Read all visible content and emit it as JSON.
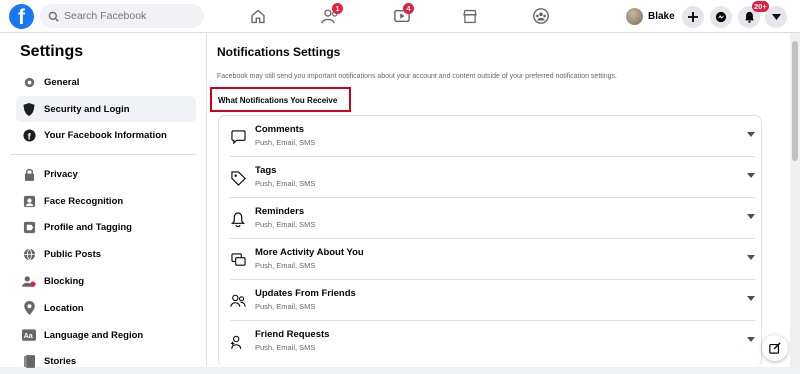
{
  "topbar": {
    "logo": "f",
    "search_placeholder": "Search Facebook",
    "badges": {
      "friends": "1",
      "watch": "4",
      "notifications": "20+"
    },
    "profile_name": "Blake"
  },
  "sidebar": {
    "title": "Settings",
    "items": [
      {
        "label": "General",
        "icon": "gear-icon"
      },
      {
        "label": "Security and Login",
        "icon": "shield-icon"
      },
      {
        "label": "Your Facebook Information",
        "icon": "facebook-icon"
      },
      {
        "label": "Privacy",
        "icon": "lock-icon"
      },
      {
        "label": "Face Recognition",
        "icon": "face-icon"
      },
      {
        "label": "Profile and Tagging",
        "icon": "tag-icon"
      },
      {
        "label": "Public Posts",
        "icon": "globe-icon"
      },
      {
        "label": "Blocking",
        "icon": "block-icon"
      },
      {
        "label": "Location",
        "icon": "pin-icon"
      },
      {
        "label": "Language and Region",
        "icon": "language-icon"
      },
      {
        "label": "Stories",
        "icon": "book-icon"
      }
    ]
  },
  "main": {
    "title": "Notifications Settings",
    "note": "Facebook may still send you important notifications about your account and content outside of your preferred notification settings.",
    "section_heading": "What Notifications You Receive",
    "rows": [
      {
        "title": "Comments",
        "sub": "Push, Email, SMS"
      },
      {
        "title": "Tags",
        "sub": "Push, Email, SMS"
      },
      {
        "title": "Reminders",
        "sub": "Push, Email, SMS"
      },
      {
        "title": "More Activity About You",
        "sub": "Push, Email, SMS"
      },
      {
        "title": "Updates From Friends",
        "sub": "Push, Email, SMS"
      },
      {
        "title": "Friend Requests",
        "sub": "Push, Email, SMS"
      }
    ]
  },
  "colors": {
    "brand": "#1877f2",
    "badge": "#e41e3f",
    "highlight": "#d0021b"
  }
}
